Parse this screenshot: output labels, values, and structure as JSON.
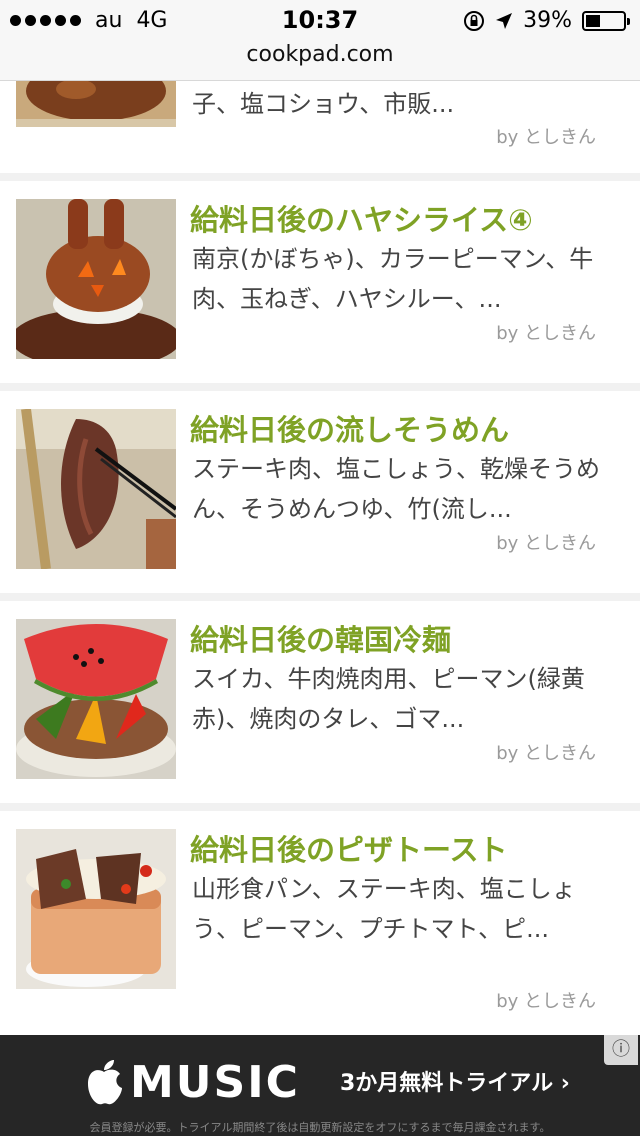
{
  "status": {
    "carrier": "au",
    "network": "4G",
    "time": "10:37",
    "battery": "39%",
    "battery_fraction": 0.39
  },
  "browser": {
    "url": "cookpad.com"
  },
  "recipes": [
    {
      "title": "",
      "ingredients": "子、塩コショウ、市販...",
      "author": "by としきん"
    },
    {
      "title": "給料日後のハヤシライス④",
      "ingredients": "南京(かぼちゃ)、カラーピーマン、牛肉、玉ねぎ、ハヤシルー、...",
      "author": "by としきん"
    },
    {
      "title": "給料日後の流しそうめん",
      "ingredients": "ステーキ肉、塩こしょう、乾燥そうめん、そうめんつゆ、竹(流し...",
      "author": "by としきん"
    },
    {
      "title": "給料日後の韓国冷麺",
      "ingredients": "スイカ、牛肉焼肉用、ピーマン(緑黄赤)、焼肉のタレ、ゴマ...",
      "author": "by としきん"
    },
    {
      "title": "給料日後のピザトースト",
      "ingredients": "山形食パン、ステーキ肉、塩こしょう、ピーマン、プチトマト、ピ...",
      "author": "by としきん"
    }
  ],
  "ad": {
    "brand": "MUSIC",
    "cta": "3か月無料トライアル ›",
    "fineprint": "会員登録が必要。トライアル期間終了後は自動更新設定をオフにするまで毎月課金されます。",
    "info": "ⓘ"
  }
}
